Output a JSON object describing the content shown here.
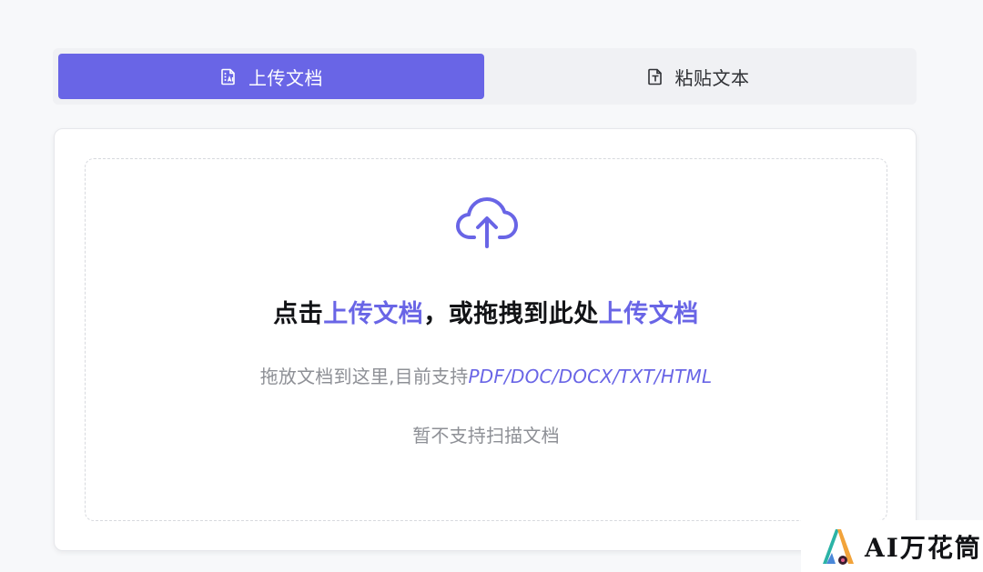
{
  "tabs": {
    "upload_label": "上传文档",
    "paste_label": "粘贴文本",
    "upload_icon": "document-upload-icon",
    "paste_icon": "text-file-icon"
  },
  "dropzone": {
    "icon": "cloud-upload-icon",
    "main_prefix": "点击",
    "main_link_1": "上传文档",
    "main_middle": "，或拖拽到此处",
    "main_link_2": "上传文档",
    "sub_prefix": "拖放文档到这里,目前支持",
    "sub_formats": "PDF/DOC/DOCX/TXT/HTML",
    "note": "暂不支持扫描文档"
  },
  "watermark": {
    "text": "AI万花筒",
    "logo": "kaleidoscope-logo"
  },
  "colors": {
    "accent": "#6965e6",
    "background": "#f7f8fa",
    "tab_bar": "#f0f1f4",
    "muted_text": "#8e9096",
    "primary_text": "#121316"
  }
}
